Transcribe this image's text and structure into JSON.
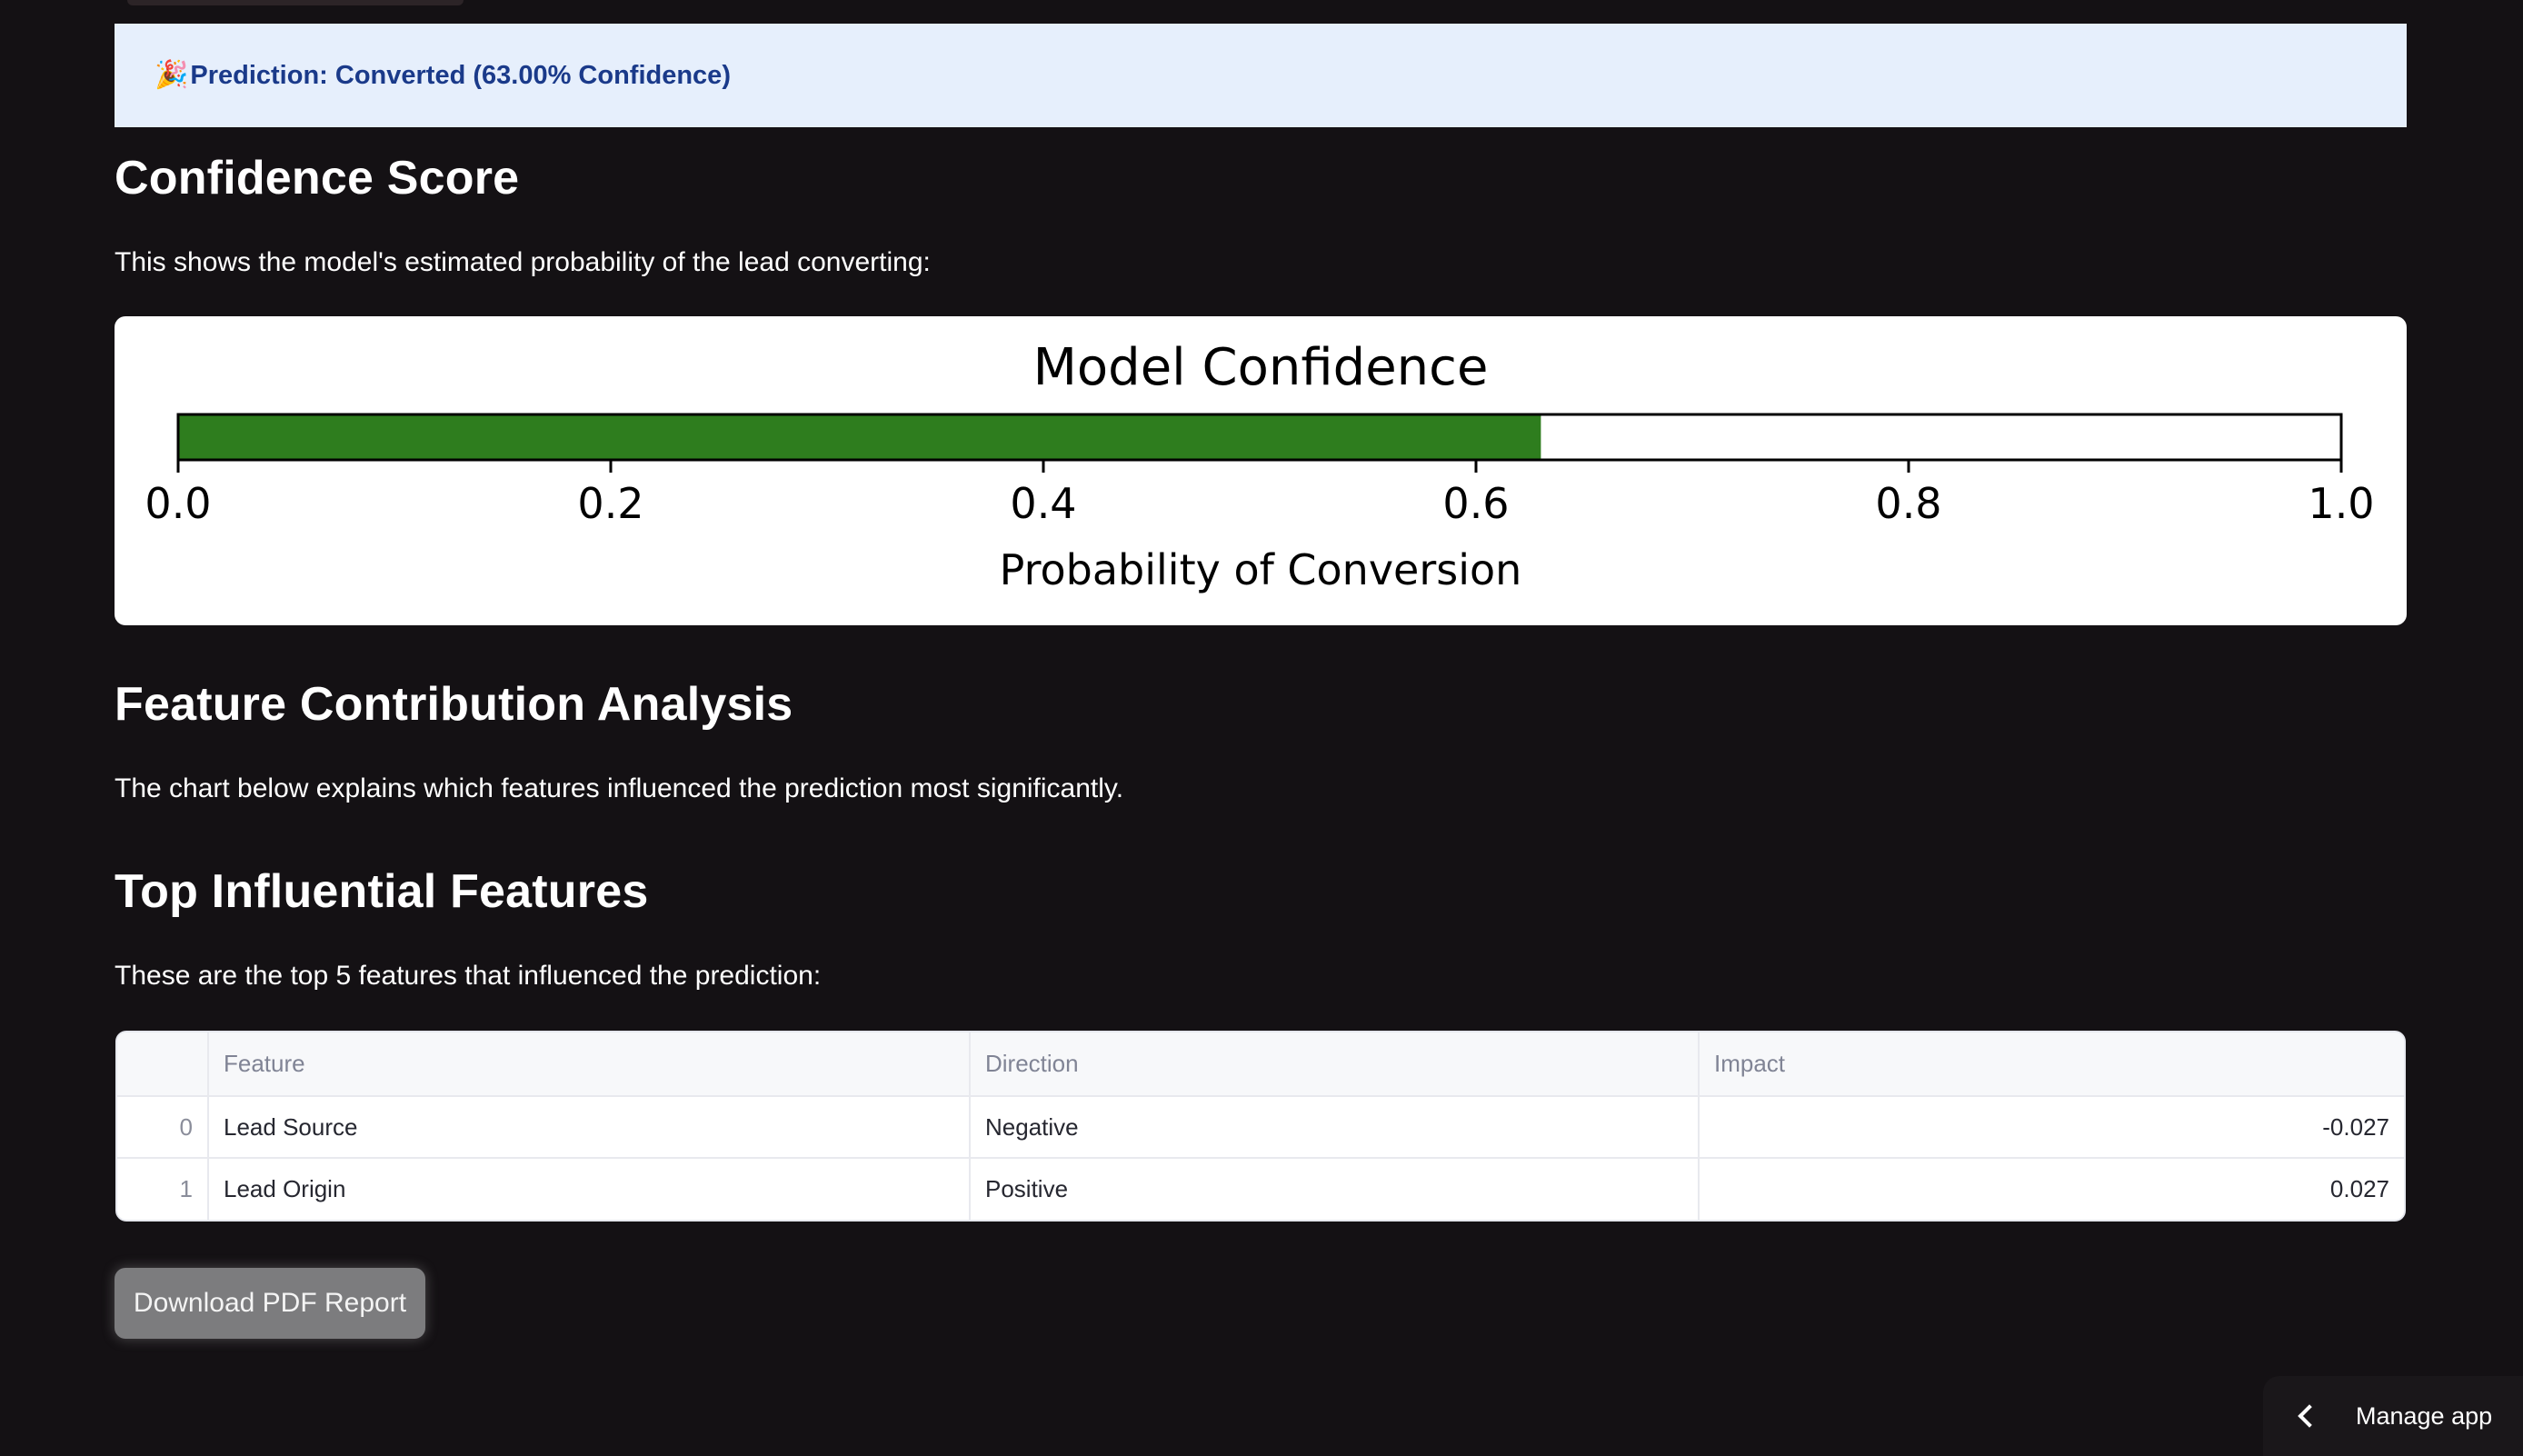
{
  "alert": {
    "icon": "🎉",
    "text": "Prediction: Converted (63.00% Confidence)",
    "color": "#1a3a8a"
  },
  "confidence_section": {
    "heading": "Confidence Score",
    "description": "This shows the model's estimated probability of the lead converting:"
  },
  "chart_data": {
    "type": "bar",
    "title": "Model Confidence",
    "xlabel": "Probability of Conversion",
    "ylabel": "",
    "xlim": [
      0,
      1
    ],
    "x_ticks": [
      "0.0",
      "0.2",
      "0.4",
      "0.6",
      "0.8",
      "1.0"
    ],
    "values": [
      0.63
    ],
    "bar_color": "#2e7d1e",
    "orientation": "horizontal"
  },
  "feature_section": {
    "heading": "Feature Contribution Analysis",
    "description": "The chart below explains which features influenced the prediction most significantly."
  },
  "top_features_section": {
    "heading": "Top Influential Features",
    "description": "These are the top 5 features that influenced the prediction:"
  },
  "table": {
    "columns": [
      "",
      "Feature",
      "Direction",
      "Impact"
    ],
    "rows": [
      {
        "index": "0",
        "feature": "Lead Source",
        "direction": "Negative",
        "impact": "-0.027"
      },
      {
        "index": "1",
        "feature": "Lead Origin",
        "direction": "Positive",
        "impact": "0.027"
      }
    ]
  },
  "download_button": {
    "label": "Download PDF Report"
  },
  "manage_app": {
    "label": "Manage app",
    "icon": "chevron-left-icon"
  }
}
